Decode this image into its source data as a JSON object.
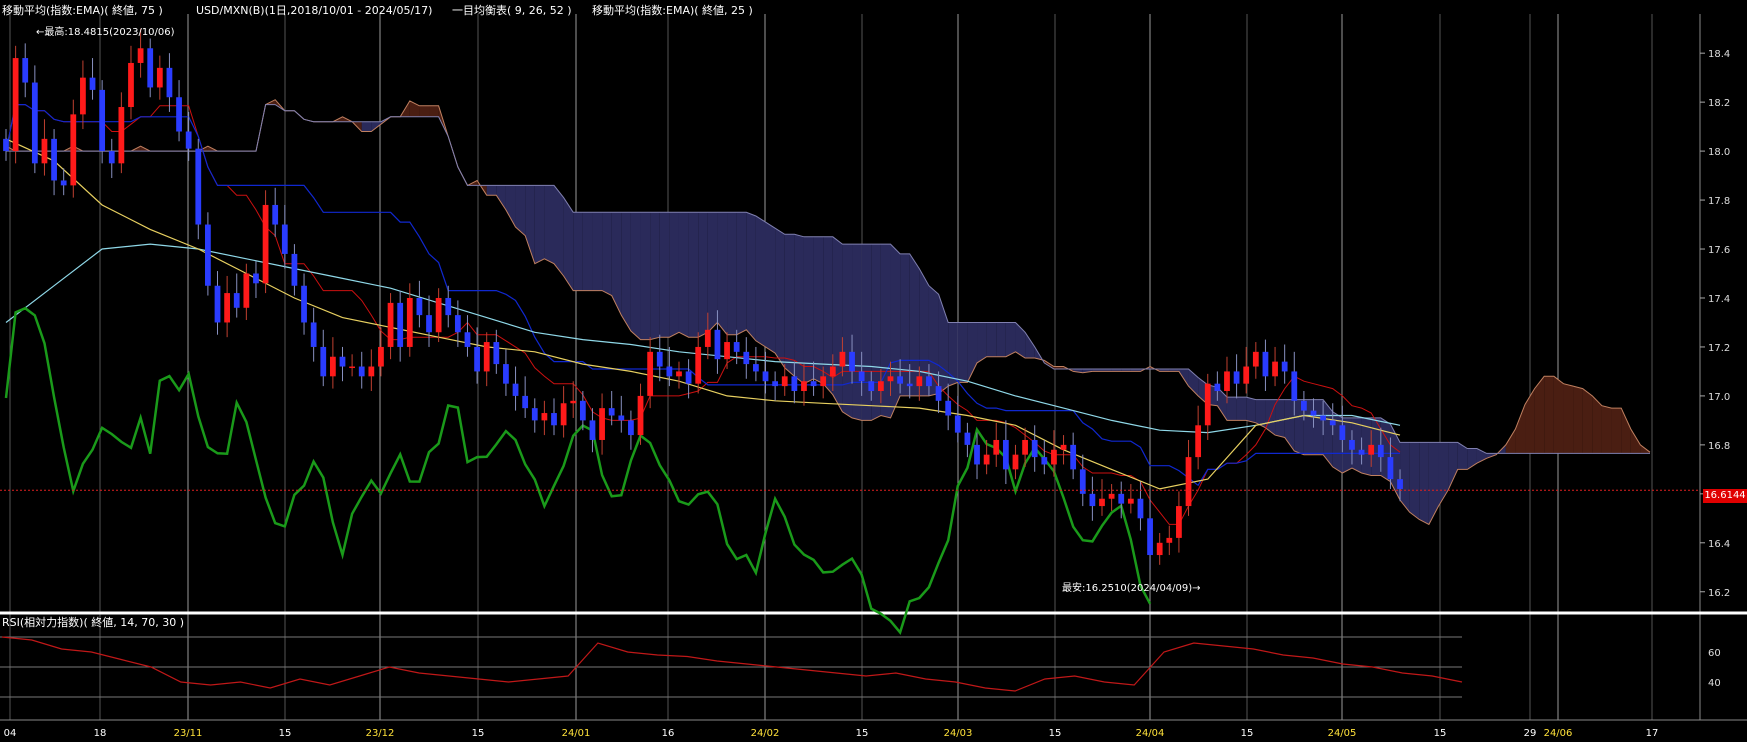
{
  "header": {
    "ema75_label": "移動平均(指数:EMA)( 終値, 75 )",
    "symbol_label": "USD/MXN(B)(1日,2018/10/01 - 2024/05/17)",
    "ichimoku_label": "一目均衡表( 9, 26, 52 )",
    "ema25_label": "移動平均(指数:EMA)( 終値, 25 )",
    "rsi_label": "RSI(相対力指数)( 終値, 14, 70, 30 )"
  },
  "annotations": {
    "high": "←最高:18.4815(2023/10/06)",
    "low": "最安:16.2510(2024/04/09)→"
  },
  "price_tag": "16.6144",
  "colors": {
    "up": "#ff1a1a",
    "down": "#2a3cff",
    "ema25": "#e8d060",
    "ema75": "#8fd8e8",
    "tenkan": "#cc1010",
    "kijun": "#1028d0",
    "chikou": "#1a9a1a",
    "kumo_bull": "#4a1e12",
    "kumo_bear": "#2a2a5a",
    "rsi": "#c01818"
  },
  "chart_data": [
    {
      "type": "candlestick",
      "title": "USD/MXN(B)(1日,2018/10/01 - 2024/05/17)",
      "x_ticks": [
        "04",
        "18",
        "23/11",
        "15",
        "23/12",
        "15",
        "24/01",
        "16",
        "24/02",
        "15",
        "24/03",
        "15",
        "24/04",
        "15",
        "24/05",
        "15",
        "29",
        "24/06",
        "17"
      ],
      "highlight_ticks": [
        "23/11",
        "23/12",
        "24/01",
        "24/02",
        "24/03",
        "24/04",
        "24/05",
        "24/06"
      ],
      "y_ticks": [
        "18.4",
        "18.2",
        "18.0",
        "17.8",
        "17.6",
        "17.4",
        "17.2",
        "17.0",
        "16.8",
        "16.6",
        "16.4",
        "16.2"
      ],
      "ylim": [
        16.15,
        18.56
      ],
      "current_price": 16.6144,
      "closes": [
        18.0,
        18.38,
        18.28,
        17.95,
        18.05,
        17.88,
        17.86,
        18.15,
        18.3,
        18.25,
        18.0,
        17.95,
        18.18,
        18.36,
        18.42,
        18.26,
        18.34,
        18.22,
        18.08,
        18.01,
        17.7,
        17.45,
        17.3,
        17.42,
        17.36,
        17.5,
        17.46,
        17.78,
        17.7,
        17.58,
        17.45,
        17.3,
        17.2,
        17.08,
        17.16,
        17.12,
        17.12,
        17.08,
        17.12,
        17.2,
        17.38,
        17.2,
        17.4,
        17.33,
        17.26,
        17.4,
        17.33,
        17.26,
        17.2,
        17.1,
        17.22,
        17.13,
        17.05,
        17.0,
        16.95,
        16.9,
        16.93,
        16.88,
        16.97,
        16.98,
        16.9,
        16.82,
        16.95,
        16.92,
        16.9,
        16.84,
        17.0,
        17.18,
        17.12,
        17.08,
        17.1,
        17.05,
        17.2,
        17.27,
        17.15,
        17.22,
        17.18,
        17.13,
        17.1,
        17.06,
        17.04,
        17.08,
        17.02,
        17.06,
        17.04,
        17.08,
        17.12,
        17.18,
        17.1,
        17.06,
        17.02,
        17.06,
        17.08,
        17.05,
        17.04,
        17.08,
        17.04,
        16.98,
        16.92,
        16.85,
        16.8,
        16.72,
        16.76,
        16.82,
        16.7,
        16.76,
        16.82,
        16.75,
        16.72,
        16.78,
        16.8,
        16.7,
        16.6,
        16.55,
        16.58,
        16.6,
        16.56,
        16.58,
        16.5,
        16.35,
        16.4,
        16.42,
        16.55,
        16.75,
        16.88,
        17.05,
        17.02,
        17.1,
        17.05,
        17.12,
        17.18,
        17.08,
        17.14,
        17.1,
        16.98,
        16.94,
        16.92,
        16.9,
        16.88,
        16.82,
        16.78,
        16.76,
        16.8,
        16.75,
        16.66,
        16.62
      ],
      "series": [
        {
          "name": "EMA25",
          "values": [
            18.05,
            17.96,
            17.78,
            17.68,
            17.6,
            17.5,
            17.4,
            17.32,
            17.28,
            17.24,
            17.2,
            17.18,
            17.13,
            17.1,
            17.06,
            17.0,
            16.98,
            16.97,
            16.96,
            16.95,
            16.92,
            16.88,
            16.78,
            16.7,
            16.62,
            16.66,
            16.88,
            16.92,
            16.89,
            16.84
          ]
        },
        {
          "name": "EMA75",
          "values": [
            17.3,
            17.45,
            17.6,
            17.62,
            17.6,
            17.56,
            17.52,
            17.48,
            17.44,
            17.38,
            17.32,
            17.26,
            17.23,
            17.21,
            17.18,
            17.16,
            17.14,
            17.13,
            17.12,
            17.1,
            17.06,
            17.0,
            16.95,
            16.9,
            16.86,
            16.85,
            16.88,
            16.92,
            16.92,
            16.88
          ]
        },
        {
          "name": "RSI14",
          "values": [
            70,
            68,
            62,
            60,
            55,
            50,
            40,
            38,
            40,
            36,
            42,
            38,
            44,
            50,
            46,
            44,
            42,
            40,
            42,
            44,
            66,
            60,
            58,
            57,
            54,
            52,
            50,
            48,
            46,
            44,
            46,
            42,
            40,
            36,
            34,
            42,
            44,
            40,
            38,
            60,
            66,
            64,
            62,
            58,
            56,
            52,
            50,
            46,
            44,
            40
          ]
        }
      ],
      "rsi_ticks": [
        "60",
        "40"
      ],
      "rsi_levels": [
        70,
        50,
        30
      ]
    }
  ]
}
